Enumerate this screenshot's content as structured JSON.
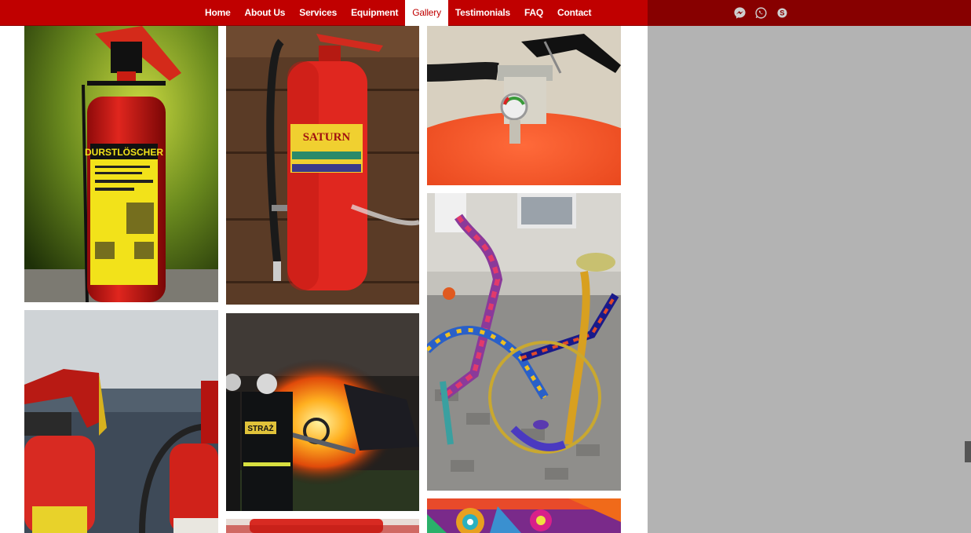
{
  "nav": {
    "items": [
      {
        "label": "Home"
      },
      {
        "label": "About Us"
      },
      {
        "label": "Services"
      },
      {
        "label": "Equipment"
      },
      {
        "label": "Gallery",
        "active": true
      },
      {
        "label": "Testimonials"
      },
      {
        "label": "FAQ"
      },
      {
        "label": "Contact"
      }
    ]
  },
  "social": {
    "icons": [
      "messenger-icon",
      "whatsapp-icon",
      "skype-icon"
    ]
  },
  "gallery": {
    "images": [
      {
        "name": "extinguisher-durstloscher",
        "label_text": "DURSTLÖSCHER"
      },
      {
        "name": "extinguisher-saturn",
        "label_text": "SATURN"
      },
      {
        "name": "extinguisher-gauge-closeup"
      },
      {
        "name": "extinguishers-pair"
      },
      {
        "name": "firefighter-car-fire",
        "label_text": "STRAŻ"
      },
      {
        "name": "knitted-bicycles"
      },
      {
        "name": "red-hydrant-partial"
      },
      {
        "name": "mandala-pattern"
      }
    ]
  },
  "colors": {
    "brand_red": "#c00000",
    "dark_red": "#870000",
    "page_grey": "#b3b3b3"
  }
}
